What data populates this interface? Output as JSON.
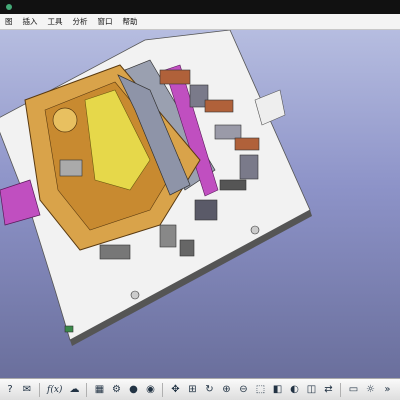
{
  "window": {
    "title": ""
  },
  "menu": [
    {
      "label": "图"
    },
    {
      "label": "插入"
    },
    {
      "label": "工具"
    },
    {
      "label": "分析"
    },
    {
      "label": "窗口"
    },
    {
      "label": "帮助"
    }
  ],
  "toolbar": {
    "formula_label": "f(x)",
    "icons": [
      "question-icon",
      "chat-icon",
      "table-icon",
      "parameter-icon",
      "light-bulb-icon",
      "record-icon",
      "pan-icon",
      "fit-all-icon",
      "rotate-icon",
      "zoom-in-icon",
      "zoom-out-icon",
      "normal-view-icon",
      "cube-view-icon",
      "shading-icon",
      "hide-show-icon",
      "swap-space-icon",
      "ruler-icon",
      "gear-icon",
      "next-icon"
    ]
  },
  "colors": {
    "viewport_top": "#b6bde0",
    "viewport_bottom": "#6a6f9c",
    "fixture_plate": "#f2f2f2",
    "part_gold": "#d9a34a",
    "part_yellow": "#e6d84a",
    "accent_magenta": "#c04fc0",
    "accent_brown": "#b0613a"
  }
}
